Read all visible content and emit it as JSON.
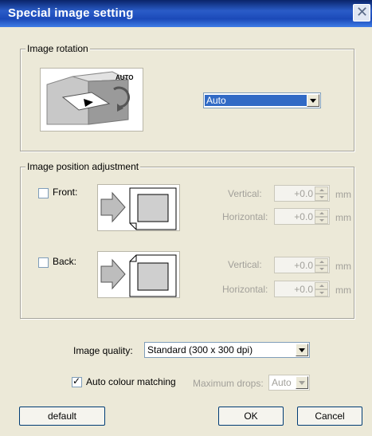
{
  "window": {
    "title": "Special image setting",
    "close_glyph": "✕"
  },
  "rotation": {
    "group_label": "Image rotation",
    "icon_text": "AUTO",
    "selected": "Auto"
  },
  "position": {
    "group_label": "Image position adjustment",
    "front": {
      "label": "Front:",
      "checked": false,
      "vertical_label": "Vertical:",
      "horizontal_label": "Horizontal:",
      "vertical_value": "+0.0",
      "horizontal_value": "+0.0",
      "unit": "mm"
    },
    "back": {
      "label": "Back:",
      "checked": false,
      "vertical_label": "Vertical:",
      "horizontal_label": "Horizontal:",
      "vertical_value": "+0.0",
      "horizontal_value": "+0.0",
      "unit": "mm"
    }
  },
  "quality": {
    "label": "Image quality:",
    "selected": "Standard (300 x 300 dpi)"
  },
  "colour": {
    "label": "Auto colour matching",
    "checked": true,
    "drops_label": "Maximum drops:",
    "drops_value": "Auto"
  },
  "buttons": {
    "default": "default",
    "ok": "OK",
    "cancel": "Cancel"
  }
}
